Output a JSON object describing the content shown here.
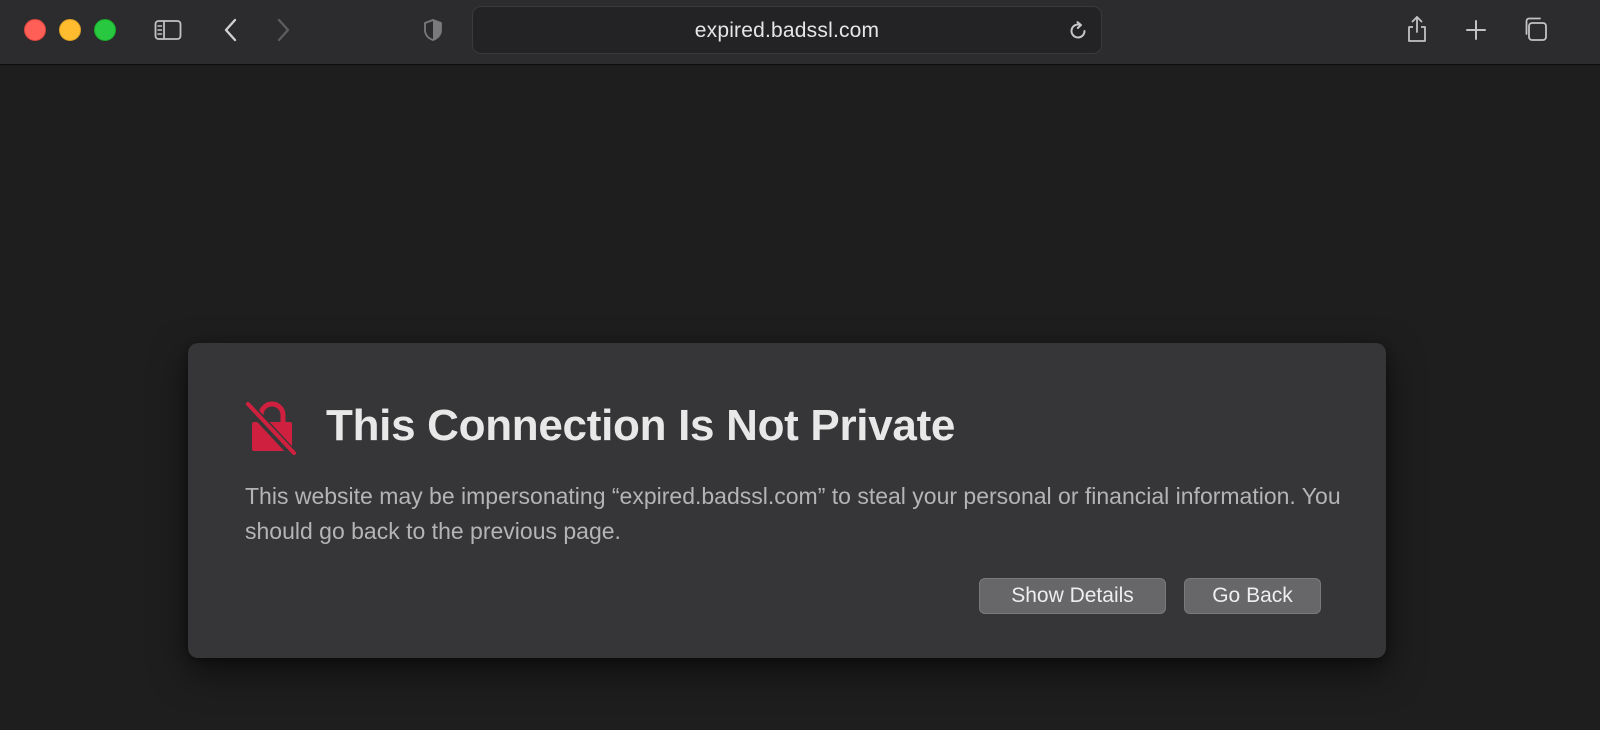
{
  "browser": {
    "address": "expired.badssl.com",
    "icons": {
      "window_controls": [
        "close-button",
        "minimize-button",
        "zoom-button"
      ],
      "left": [
        "sidebar-icon",
        "back-chevron-icon",
        "forward-chevron-icon",
        "shield-icon"
      ],
      "address": "reload-icon",
      "right": [
        "share-icon",
        "plus-icon",
        "tabs-overview-icon"
      ]
    }
  },
  "error": {
    "icon": "lock-slash-icon",
    "icon_color": "#d0203f",
    "title": "This Connection Is Not Private",
    "message": "This website may be impersonating “expired.badssl.com” to steal your personal or financial information. You should go back to the previous page.",
    "buttons": {
      "show_details": "Show Details",
      "go_back": "Go Back"
    }
  },
  "colors": {
    "page_background": "#1e1e1e",
    "toolbar": "#2c2c2e",
    "card": "#363638",
    "button": "#67676a"
  }
}
